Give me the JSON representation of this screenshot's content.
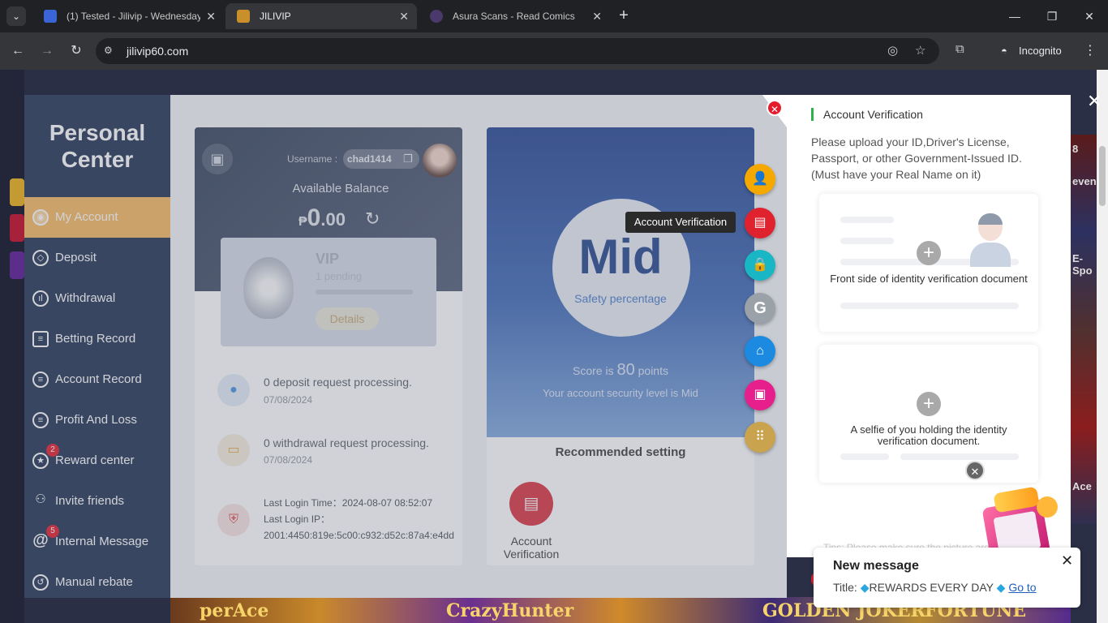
{
  "browser": {
    "tabs": [
      {
        "title": "(1) Tested - Jilivip - Wednesday",
        "favicon_color": "#3b64d6"
      },
      {
        "title": "JILIVIP",
        "favicon_color": "#c98f2a"
      },
      {
        "title": "Asura Scans - Read Comics",
        "favicon_color": "#4a3a6b"
      }
    ],
    "url": "jilivip60.com",
    "incognito_label": "Incognito"
  },
  "background": {
    "bottom_strip": [
      "perAce",
      "CrazyHunter",
      "GOLDEN JOKER",
      "FORTUNE GEMS"
    ],
    "right_strip": [
      "Ace",
      "E-Spo",
      "even",
      "8"
    ]
  },
  "personal_center": {
    "title": "Personal Center",
    "menu": [
      {
        "label": "My Account",
        "icon": "account-icon",
        "active": true
      },
      {
        "label": "Deposit",
        "icon": "deposit-icon"
      },
      {
        "label": "Withdrawal",
        "icon": "withdrawal-icon"
      },
      {
        "label": "Betting Record",
        "icon": "betting-record-icon"
      },
      {
        "label": "Account Record",
        "icon": "account-record-icon"
      },
      {
        "label": "Profit And Loss",
        "icon": "profit-loss-icon"
      },
      {
        "label": "Reward center",
        "icon": "reward-icon",
        "badge": "2"
      },
      {
        "label": "Invite friends",
        "icon": "invite-icon"
      },
      {
        "label": "Internal Message",
        "icon": "at-icon",
        "badge": "5"
      },
      {
        "label": "Manual rebate",
        "icon": "rebate-icon"
      }
    ]
  },
  "account": {
    "username_label": "Username :",
    "username": "chad1414",
    "balance_label": "Available Balance",
    "currency": "₱",
    "balance_int": "0",
    "balance_dec": ".00",
    "vip_title": "VIP",
    "vip_sub": "1 pending",
    "details_label": "Details",
    "deposit_request": "0 deposit request processing.",
    "deposit_date": "07/08/2024",
    "withdrawal_request": "0 withdrawal request processing.",
    "withdrawal_date": "07/08/2024",
    "last_login_time": "Last Login Time：2024-08-07 08:52:07",
    "last_login_ip_label": "Last Login IP：",
    "last_login_ip": "2001:4450:819e:5c00:c932:d52c:87a4:e4dd"
  },
  "security": {
    "level": "Mid",
    "safety_label": "Safety percentage",
    "score_prefix": "Score is ",
    "score": "80",
    "score_suffix": " points",
    "level_text": "Your account security level is Mid",
    "recommended_title": "Recommended setting",
    "recommended_item": "Account Verification"
  },
  "fab": [
    {
      "name": "user-icon",
      "color": "#f5a800"
    },
    {
      "name": "id-card-icon",
      "color": "#e0222e"
    },
    {
      "name": "lock-icon",
      "color": "#19b7c5"
    },
    {
      "name": "google-icon",
      "color": "#9ba1a8"
    },
    {
      "name": "bank-icon",
      "color": "#1b8ae0"
    },
    {
      "name": "wallet-icon",
      "color": "#e61f8d"
    },
    {
      "name": "keypad-icon",
      "color": "#c9a34e"
    }
  ],
  "tooltip": "Account Verification",
  "verification": {
    "title": "Account Verification",
    "description": "Please upload your ID,Driver's License, Passport, or other Government-Issued ID. (Must have your Real Name on it)",
    "front_label": "Front side of identity verification document",
    "selfie_label": "A selfie of you holding the identity verification document.",
    "faded_text": "Tips: Please make sure the picture are all..."
  },
  "message": {
    "title": "New message",
    "body_prefix": "Title: ",
    "body_text": "REWARDS EVERY DAY",
    "link": "Go to"
  }
}
